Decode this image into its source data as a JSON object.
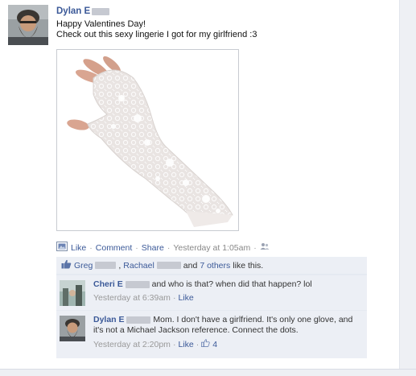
{
  "post": {
    "author": "Dylan E",
    "message_line1": "Happy Valentines Day!",
    "message_line2": "Check out this sexy lingerie I got for my girlfriend :3",
    "actions": {
      "like": "Like",
      "comment": "Comment",
      "share": "Share",
      "timestamp": "Yesterday at 1:05am",
      "separator": "·"
    }
  },
  "likes": {
    "person1": "Greg",
    "comma": ",",
    "person2": "Rachael",
    "and": "and",
    "others": "7 others",
    "suffix": "like this."
  },
  "comments": [
    {
      "author": "Cheri E",
      "text": "and who is that? when did that happen? lol",
      "timestamp": "Yesterday at 6:39am",
      "like": "Like"
    },
    {
      "author": "Dylan E",
      "text": "Mom. I don't have a girlfriend. It's only one glove, and it's not a Michael Jackson reference. Connect the dots.",
      "timestamp": "Yesterday at 2:20pm",
      "like": "Like",
      "like_count": "4"
    }
  ],
  "colors": {
    "link": "#3b5998",
    "ufi_background": "#eceff5"
  },
  "icons": [
    "photo-icon",
    "friends-icon",
    "thumbs-up-icon"
  ]
}
